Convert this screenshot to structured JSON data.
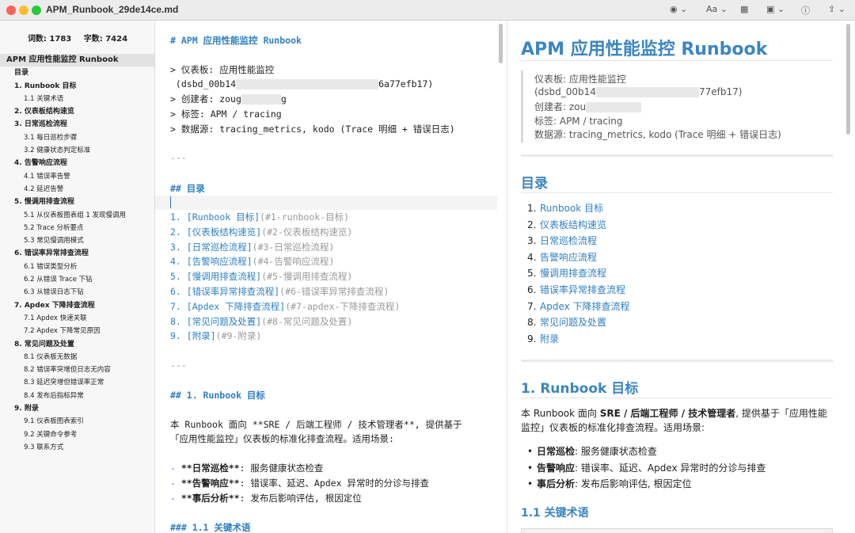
{
  "window": {
    "title": "APM_Runbook_29de14ce.md",
    "toolbar": {
      "eye": "◉ ⌄",
      "font": "Aa ⌄",
      "table": "▦",
      "image": "▣ ⌄",
      "info": "ⓘ",
      "share": "⇪ ⌄"
    }
  },
  "sidebar": {
    "word_count": "词数: 1783",
    "char_count": "字数: 7424",
    "toc": [
      {
        "level": 0,
        "label": "APM 应用性能监控 Runbook"
      },
      {
        "level": 1,
        "label": "目录"
      },
      {
        "level": 1,
        "label": "1. Runbook 目标"
      },
      {
        "level": 2,
        "label": "1.1 关键术语"
      },
      {
        "level": 1,
        "label": "2. 仪表板结构速览"
      },
      {
        "level": 1,
        "label": "3. 日常巡检流程"
      },
      {
        "level": 2,
        "label": "3.1 每日巡检步骤"
      },
      {
        "level": 2,
        "label": "3.2 健康状态判定标准"
      },
      {
        "level": 1,
        "label": "4. 告警响应流程"
      },
      {
        "level": 2,
        "label": "4.1 错误率告警"
      },
      {
        "level": 2,
        "label": "4.2 延迟告警"
      },
      {
        "level": 1,
        "label": "5. 慢调用排查流程"
      },
      {
        "level": 2,
        "label": "5.1 从仪表板图表组 1 发现慢调用"
      },
      {
        "level": 2,
        "label": "5.2 Trace 分析要点"
      },
      {
        "level": 2,
        "label": "5.3 常见慢调用模式"
      },
      {
        "level": 1,
        "label": "6. 错误率异常排查流程"
      },
      {
        "level": 2,
        "label": "6.1 错误类型分析"
      },
      {
        "level": 2,
        "label": "6.2 从错误 Trace 下钻"
      },
      {
        "level": 2,
        "label": "6.3 从错误日志下钻"
      },
      {
        "level": 1,
        "label": "7. Apdex 下降排查流程"
      },
      {
        "level": 2,
        "label": "7.1 Apdex 快速关联"
      },
      {
        "level": 2,
        "label": "7.2 Apdex 下降常见原因"
      },
      {
        "level": 1,
        "label": "8. 常见问题及处置"
      },
      {
        "level": 2,
        "label": "8.1 仪表板无数据"
      },
      {
        "level": 2,
        "label": "8.2 错误率突增但日志无内容"
      },
      {
        "level": 2,
        "label": "8.3 延迟突增但错误率正常"
      },
      {
        "level": 2,
        "label": "8.4 发布后指标异常"
      },
      {
        "level": 1,
        "label": "9. 附录"
      },
      {
        "level": 2,
        "label": "9.1 仪表板图表索引"
      },
      {
        "level": 2,
        "label": "9.2 关键命令参考"
      },
      {
        "level": 2,
        "label": "9.3 联系方式"
      }
    ]
  },
  "editor": {
    "h1": "# APM 应用性能监控 Runbook",
    "q1": "> 仪表板: 应用性能监控",
    "q2a": " (dsbd_00b14",
    "q2b": "6a77efb17)",
    "q3a": "> 创建者: zoug",
    "q3b": "g",
    "q4": "> 标签: APM / tracing",
    "q5": "> 数据源: tracing_metrics, kodo (Trace 明细 + 错误日志)",
    "hr1": "---",
    "h2_toc": "## 目录",
    "toc_lines": [
      {
        "num": "1.",
        "text": "[Runbook 目标]",
        "anchor": "(#1-runbook-目标)"
      },
      {
        "num": "2.",
        "text": "[仪表板结构速览]",
        "anchor": "(#2-仪表板结构速览)"
      },
      {
        "num": "3.",
        "text": "[日常巡检流程]",
        "anchor": "(#3-日常巡检流程)"
      },
      {
        "num": "4.",
        "text": "[告警响应流程]",
        "anchor": "(#4-告警响应流程)"
      },
      {
        "num": "5.",
        "text": "[慢调用排查流程]",
        "anchor": "(#5-慢调用排查流程)"
      },
      {
        "num": "6.",
        "text": "[错误率异常排查流程]",
        "anchor": "(#6-错误率异常排查流程)"
      },
      {
        "num": "7.",
        "text": "[Apdex 下降排查流程]",
        "anchor": "(#7-apdex-下降排查流程)"
      },
      {
        "num": "8.",
        "text": "[常见问题及处置]",
        "anchor": "(#8-常见问题及处置)"
      },
      {
        "num": "9.",
        "text": "[附录]",
        "anchor": "(#9-附录)"
      }
    ],
    "hr2": "---",
    "h2_goal": "## 1. Runbook 目标",
    "para1a": "本 Runbook 面向 **SRE / 后端工程师 / 技术管理者**, 提供基于",
    "para1b": "「应用性能监控」仪表板的标准化排查流程。适用场景:",
    "bul1a": "- ",
    "bul1b": "**日常巡检**",
    "bul1c": ": 服务健康状态检查",
    "bul2a": "- ",
    "bul2b": "**告警响应**",
    "bul2c": ": 错误率、延迟、Apdex 异常时的分诊与排查",
    "bul3a": "- ",
    "bul3b": "**事后分析**",
    "bul3c": ": 发布后影响评估, 根因定位",
    "h3_terms": "### 1.1 关键术语"
  },
  "preview": {
    "h1": "APM 应用性能监控 Runbook",
    "q1": "仪表板: 应用性能监控",
    "q2a": "(dsbd_00b14",
    "q2b": "77efb17)",
    "q3": "创建者: zou",
    "q4": "标签: APM / tracing",
    "q5": "数据源: tracing_metrics, kodo (Trace 明细 + 错误日志)",
    "h2_toc": "目录",
    "toc": [
      {
        "num": "1.",
        "text": "Runbook 目标"
      },
      {
        "num": "2.",
        "text": "仪表板结构速览"
      },
      {
        "num": "3.",
        "text": "日常巡检流程"
      },
      {
        "num": "4.",
        "text": "告警响应流程"
      },
      {
        "num": "5.",
        "text": "慢调用排查流程"
      },
      {
        "num": "6.",
        "text": "错误率异常排查流程"
      },
      {
        "num": "7.",
        "text": "Apdex 下降排查流程"
      },
      {
        "num": "8.",
        "text": "常见问题及处置"
      },
      {
        "num": "9.",
        "text": "附录"
      }
    ],
    "h2_goal": "1. Runbook 目标",
    "para1_pre": "本 Runbook 面向 ",
    "para1_bold": "SRE / 后端工程师 / 技术管理者",
    "para1_post": ", 提供基于「应用性能监控」仪表板的标准化排查流程。适用场景:",
    "bullets": [
      {
        "bold": "日常巡检",
        "text": ": 服务健康状态检查"
      },
      {
        "bold": "告警响应",
        "text": ": 错误率、延迟、Apdex 异常时的分诊与排查"
      },
      {
        "bold": "事后分析",
        "text": ": 发布后影响评估, 根因定位"
      }
    ],
    "h3_terms": "1.1 关键术语"
  }
}
